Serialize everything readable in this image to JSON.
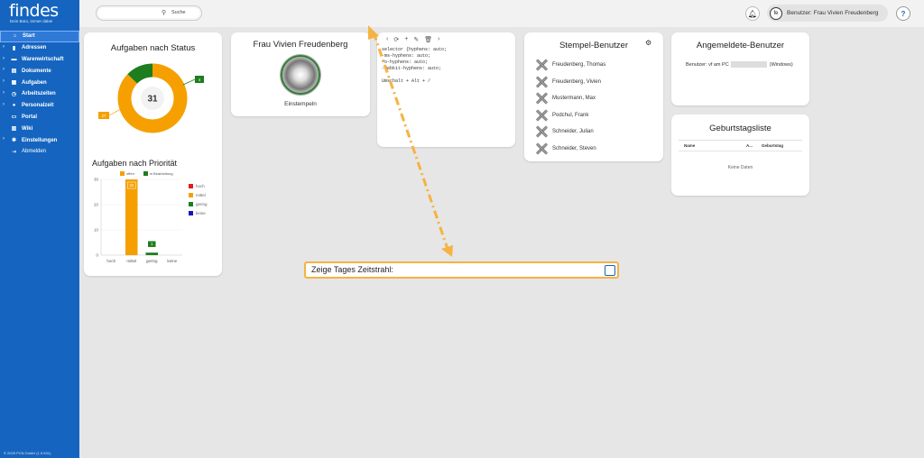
{
  "sidebar": {
    "logo_title": "findes",
    "logo_subtitle": "Dein Büro, immer dabei",
    "items": [
      {
        "label": "Start",
        "icon": "home-icon",
        "active": true
      },
      {
        "label": "Adressen",
        "icon": "address-icon"
      },
      {
        "label": "Warenwirtschaft",
        "icon": "truck-icon"
      },
      {
        "label": "Dokumente",
        "icon": "document-icon"
      },
      {
        "label": "Aufgaben",
        "icon": "task-icon"
      },
      {
        "label": "Arbeitszeiten",
        "icon": "clock-icon"
      },
      {
        "label": "Personalzeit",
        "icon": "person-icon"
      },
      {
        "label": "Portal",
        "icon": "monitor-icon"
      },
      {
        "label": "Wiki",
        "icon": "book-icon"
      },
      {
        "label": "Einstellungen",
        "icon": "gear-icon"
      },
      {
        "label": "Abmelden",
        "icon": "logout-icon"
      }
    ],
    "footer": "© 2025 PCN GmbH (1.5.531)"
  },
  "topbar": {
    "search_label": "Suche",
    "user_label": "Benutzer: Frau Vivien Freudenberg",
    "avatar_text": "fe",
    "help_text": "?"
  },
  "tasks_card": {
    "title": "Aufgaben nach Status",
    "center_value": "31",
    "legend": [
      "offen",
      "in Bearbeitung"
    ],
    "priority_title": "Aufgaben nach Priorität",
    "priority_legend": [
      "hoch",
      "mittel",
      "gering",
      "keine"
    ]
  },
  "chart_data": [
    {
      "type": "pie",
      "title": "Aufgaben nach Status",
      "categories": [
        "offen",
        "in Bearbeitung"
      ],
      "values": [
        27,
        4
      ],
      "colors": [
        "#f5a000",
        "#1e7d1e"
      ],
      "center_label": "31"
    },
    {
      "type": "bar",
      "title": "Aufgaben nach Priorität",
      "categories": [
        "hoch",
        "mittel",
        "gering",
        "keine"
      ],
      "values": [
        0,
        30,
        1,
        0
      ],
      "colors": [
        "#e41a1c",
        "#f5a000",
        "#1e7d1e",
        "#1414c8"
      ],
      "ylim": [
        0,
        30
      ],
      "yticks": [
        0,
        10,
        20,
        30
      ]
    }
  ],
  "vivien_card": {
    "title": "Frau Vivien Freudenberg",
    "button_label": "Einstempeln"
  },
  "editor_card": {
    "tools": [
      "‹",
      "⟳",
      "+",
      "✎",
      "🗑",
      "›"
    ],
    "lines": [
      "selector {hyphens: auto;",
      "-ms-hyphens: auto;",
      "-o-hyphens: auto;",
      "-webkit-hyphens: auto;",
      "",
      "Umschalt + Alt + /"
    ]
  },
  "stempel_card": {
    "title": "Stempel-Benutzer",
    "users": [
      "Freudenberg, Thomas",
      "Freudenberg, Vivien",
      "Mustermann, Max",
      "Podchul, Frank",
      "Schneider, Julian",
      "Schneider, Steven"
    ]
  },
  "angemeldet_card": {
    "title": "Angemeldete-Benutzer",
    "line_prefix": "Benutzer: vf am PC",
    "line_suffix": "(Windows)"
  },
  "geburtstag_card": {
    "title": "Geburtstagsliste",
    "columns": [
      "Name",
      "A...",
      "Geburtstag"
    ],
    "empty_text": "Keine Daten"
  },
  "zeitstrahl": {
    "label": "Zeige Tages Zeitstrahl:"
  },
  "colors": {
    "sidebar": "#1565c0",
    "accent": "#f5b342",
    "open": "#f5a000",
    "in_progress": "#1e7d1e"
  }
}
